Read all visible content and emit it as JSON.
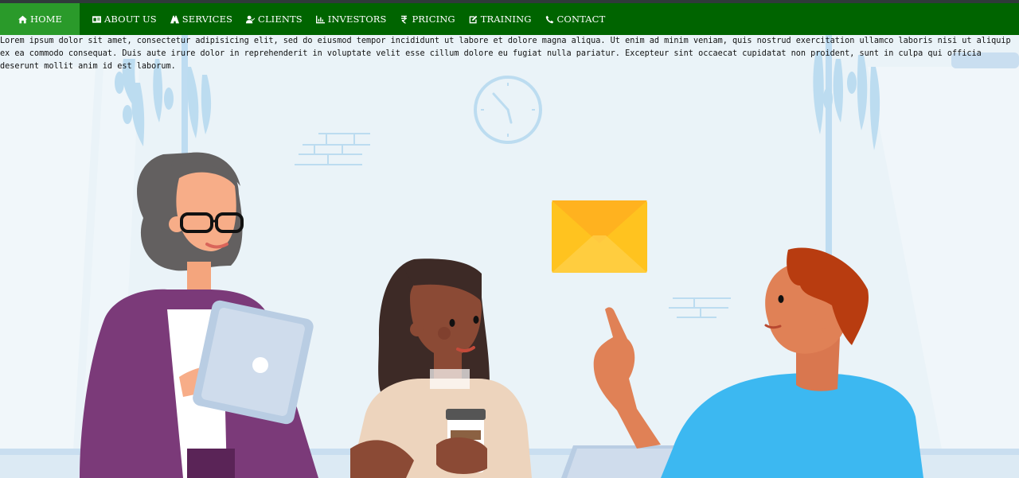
{
  "nav": {
    "items": [
      {
        "label": "HOME",
        "icon": "home-icon",
        "active": true
      },
      {
        "label": "ABOUT US",
        "icon": "id-card-icon",
        "active": false
      },
      {
        "label": "SERVICES",
        "icon": "road-icon",
        "active": false
      },
      {
        "label": "CLIENTS",
        "icon": "user-check-icon",
        "active": false
      },
      {
        "label": "INVESTORS",
        "icon": "chart-icon",
        "active": false
      },
      {
        "label": "PRICING",
        "icon": "rupee-icon",
        "active": false
      },
      {
        "label": "TRAINING",
        "icon": "edit-icon",
        "active": false
      },
      {
        "label": "CONTACT",
        "icon": "phone-icon",
        "active": false
      }
    ]
  },
  "intro_text": "Lorem ipsum dolor sit amet, consectetur adipisicing elit, sed do eiusmod tempor incididunt ut labore et dolore magna aliqua. Ut enim ad minim veniam, quis nostrud exercitation ullamco laboris nisi ut aliquip ex ea commodo consequat. Duis aute irure dolor in reprehenderit in voluptate velit esse cillum dolore eu fugiat nulla pariatur. Excepteur sint occaecat cupidatat non proident, sunt in culpa qui officia deserunt mollit anim id est laborum.",
  "colors": {
    "navbar": "#006400",
    "nav_active": "#2a9a2a",
    "background": "#eaf3f8"
  }
}
